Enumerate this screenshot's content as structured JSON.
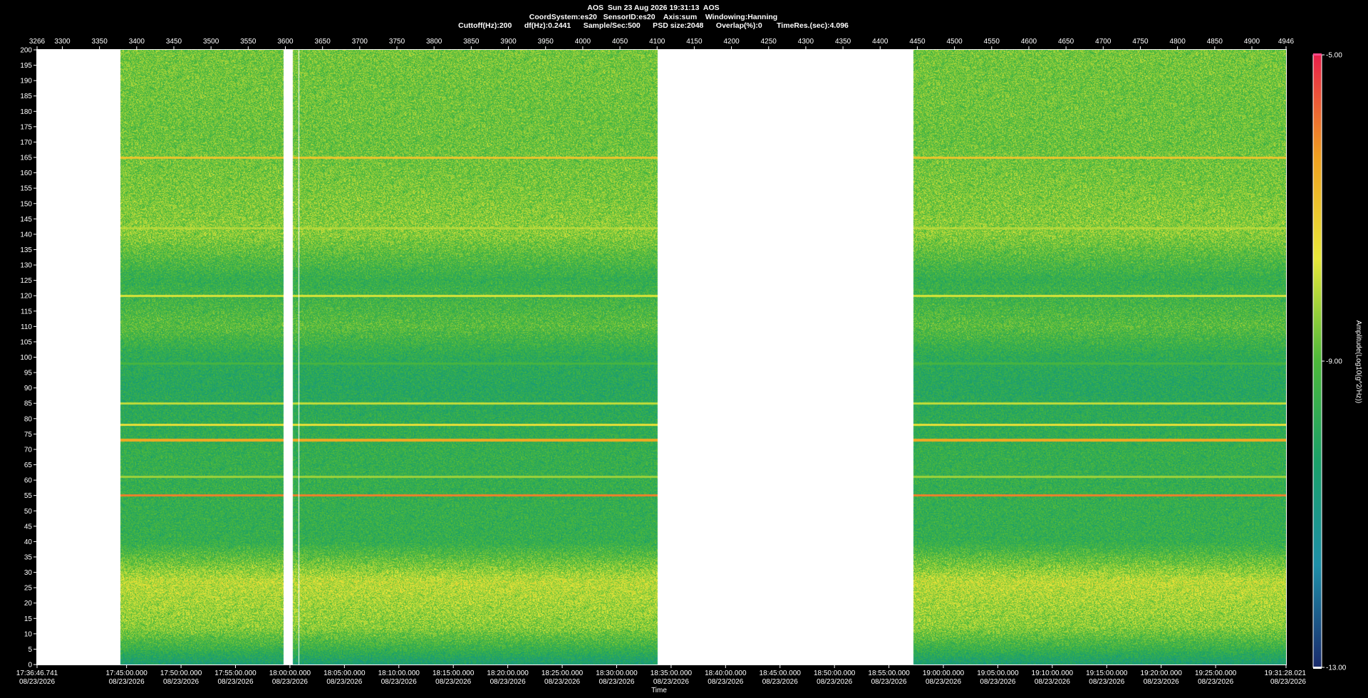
{
  "header": {
    "line1": "AOS  Sun 23 Aug 2026 19:31:13  AOS",
    "line2": "CoordSystem:es20   SensorID:es20    Axis:sum    Windowing:Hanning",
    "line3": "Cuttoff(Hz):200      df(Hz):0.2441      Sample/Sec:500      PSD size:2048      Overlap(%):0       TimeRes.(sec):4.096"
  },
  "chart_data": {
    "type": "heatmap",
    "title": "AOS  Sun 23 Aug 2026 19:31:13  AOS",
    "xlabel": "Time",
    "ylabel": "",
    "colorbar_label": "Amplitude(Log10(g^2/Hz))",
    "colorbar_ticks": [
      "-5.00",
      "-9.00",
      "-13.00"
    ],
    "colorbar_range": [
      -13,
      -5
    ],
    "colormap": [
      "#1a2a6c",
      "#1e8fa8",
      "#1aa06a",
      "#4cb83a",
      "#e8e83a",
      "#f0a020",
      "#e8204a"
    ],
    "ylim": [
      0,
      200
    ],
    "y_ticks": [
      200,
      195,
      190,
      185,
      180,
      175,
      170,
      165,
      160,
      155,
      150,
      145,
      140,
      135,
      130,
      125,
      120,
      115,
      110,
      105,
      100,
      95,
      90,
      85,
      80,
      75,
      70,
      65,
      60,
      55,
      50,
      45,
      40,
      35,
      30,
      25,
      20,
      15,
      10,
      5,
      0
    ],
    "top_axis": {
      "range": [
        3266,
        4946
      ],
      "ticks": [
        "3266",
        "3300",
        "3350",
        "3400",
        "3450",
        "3500",
        "3550",
        "3600",
        "3650",
        "3700",
        "3750",
        "3800",
        "3850",
        "3900",
        "3950",
        "4000",
        "4050",
        "4100",
        "4150",
        "4200",
        "4250",
        "4300",
        "4350",
        "4400",
        "4450",
        "4500",
        "4550",
        "4600",
        "4650",
        "4700",
        "4750",
        "4800",
        "4850",
        "4900",
        "4946"
      ]
    },
    "time_axis": {
      "start_sec": 0,
      "end_sec": 6881.28,
      "ticks": [
        {
          "t": 0,
          "time": "17:36:46.741",
          "date": "08/23/2026"
        },
        {
          "t": 493.26,
          "time": "17:45:00.000",
          "date": "08/23/2026"
        },
        {
          "t": 793.26,
          "time": "17:50:00.000",
          "date": "08/23/2026"
        },
        {
          "t": 1093.26,
          "time": "17:55:00.000",
          "date": "08/23/2026"
        },
        {
          "t": 1393.26,
          "time": "18:00:00.000",
          "date": "08/23/2026"
        },
        {
          "t": 1693.26,
          "time": "18:05:00.000",
          "date": "08/23/2026"
        },
        {
          "t": 1993.26,
          "time": "18:10:00.000",
          "date": "08/23/2026"
        },
        {
          "t": 2293.26,
          "time": "18:15:00.000",
          "date": "08/23/2026"
        },
        {
          "t": 2593.26,
          "time": "18:20:00.000",
          "date": "08/23/2026"
        },
        {
          "t": 2893.26,
          "time": "18:25:00.000",
          "date": "08/23/2026"
        },
        {
          "t": 3193.26,
          "time": "18:30:00.000",
          "date": "08/23/2026"
        },
        {
          "t": 3493.26,
          "time": "18:35:00.000",
          "date": "08/23/2026"
        },
        {
          "t": 3793.26,
          "time": "18:40:00.000",
          "date": "08/23/2026"
        },
        {
          "t": 4093.26,
          "time": "18:45:00.000",
          "date": "08/23/2026"
        },
        {
          "t": 4393.26,
          "time": "18:50:00.000",
          "date": "08/23/2026"
        },
        {
          "t": 4693.26,
          "time": "18:55:00.000",
          "date": "08/23/2026"
        },
        {
          "t": 4993.26,
          "time": "19:00:00.000",
          "date": "08/23/2026"
        },
        {
          "t": 5293.26,
          "time": "19:05:00.000",
          "date": "08/23/2026"
        },
        {
          "t": 5593.26,
          "time": "19:10:00.000",
          "date": "08/23/2026"
        },
        {
          "t": 5893.26,
          "time": "19:15:00.000",
          "date": "08/23/2026"
        },
        {
          "t": 6193.26,
          "time": "19:20:00.000",
          "date": "08/23/2026"
        },
        {
          "t": 6493.26,
          "time": "19:25:00.000",
          "date": "08/23/2026"
        },
        {
          "t": 6881.28,
          "time": "19:31:28.021",
          "date": "08/23/2026"
        }
      ]
    },
    "data_gaps_sec": [
      [
        0,
        458
      ],
      [
        1358,
        1410
      ],
      [
        1440,
        1446
      ],
      [
        3420,
        4830
      ]
    ],
    "narrowband_lines_hz": [
      {
        "f": 55,
        "level": -6.0
      },
      {
        "f": 73,
        "level": -6.5
      },
      {
        "f": 78,
        "level": -7.5
      },
      {
        "f": 85,
        "level": -8.0
      },
      {
        "f": 120,
        "level": -7.8
      },
      {
        "f": 142,
        "level": -8.2
      },
      {
        "f": 165,
        "level": -7.0
      },
      {
        "f": 61,
        "level": -8.3
      },
      {
        "f": 98,
        "level": -9.2
      }
    ],
    "background_profile_hz": [
      {
        "f": 0,
        "level": -10.5
      },
      {
        "f": 5,
        "level": -9.5
      },
      {
        "f": 12,
        "level": -8.5
      },
      {
        "f": 27,
        "level": -8.0
      },
      {
        "f": 40,
        "level": -9.6
      },
      {
        "f": 70,
        "level": -9.6
      },
      {
        "f": 90,
        "level": -10.0
      },
      {
        "f": 100,
        "level": -9.8
      },
      {
        "f": 110,
        "level": -9.0
      },
      {
        "f": 125,
        "level": -9.6
      },
      {
        "f": 140,
        "level": -8.5
      },
      {
        "f": 170,
        "level": -8.8
      },
      {
        "f": 200,
        "level": -8.7
      }
    ]
  }
}
